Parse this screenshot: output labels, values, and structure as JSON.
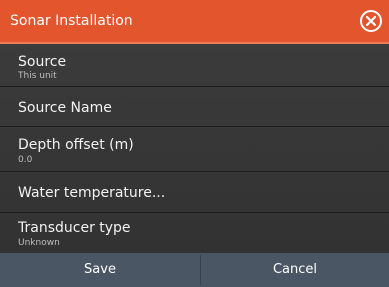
{
  "dialog": {
    "title": "Sonar Installation",
    "close_icon": "close-circle-icon"
  },
  "items": [
    {
      "label": "Source",
      "sub": "This unit"
    },
    {
      "label": "Source Name"
    },
    {
      "label": "Depth offset (m)",
      "sub": "0.0"
    },
    {
      "label": "Water temperature..."
    },
    {
      "label": "Transducer type",
      "sub": "Unknown"
    }
  ],
  "footer": {
    "save_label": "Save",
    "cancel_label": "Cancel"
  },
  "colors": {
    "title_bar": "#e3552c",
    "footer": "#4a5663",
    "background": "#2e2e2e"
  }
}
